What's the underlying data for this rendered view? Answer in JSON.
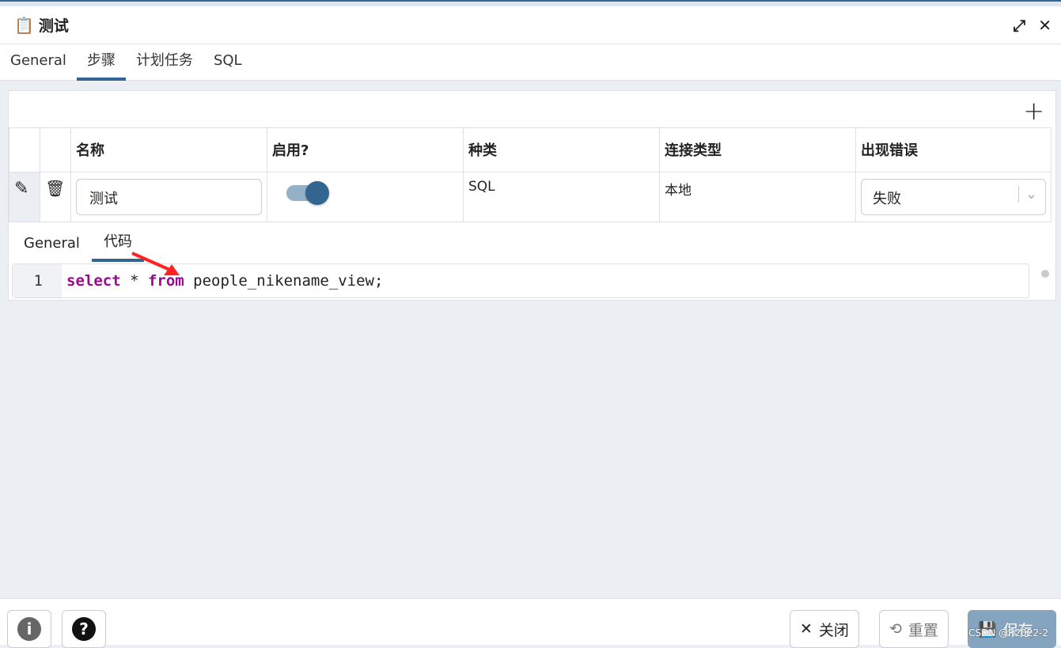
{
  "window": {
    "title": "测试",
    "icon": "clipboard-list-icon"
  },
  "tabs": [
    {
      "label": "General"
    },
    {
      "label": "步骤",
      "active": true
    },
    {
      "label": "计划任务"
    },
    {
      "label": "SQL"
    }
  ],
  "steps": {
    "headers": [
      "名称",
      "启用?",
      "种类",
      "连接类型",
      "出现错误"
    ],
    "rows": [
      {
        "name": "测试",
        "enabled": true,
        "kind": "SQL",
        "connection": "本地",
        "on_error": "失败"
      }
    ]
  },
  "subtabs": [
    {
      "label": "General"
    },
    {
      "label": "代码",
      "active": true
    }
  ],
  "code": {
    "line": "1",
    "kw1": "select",
    "star": " * ",
    "kw2": "from",
    "rest": " people_nikename_view;"
  },
  "footer": {
    "close": "关闭",
    "reset": "重置",
    "save": "保存",
    "watermark": "CSDN @R2022-2"
  },
  "colors": {
    "accent": "#326690",
    "keyword": "#9a0a8f"
  }
}
